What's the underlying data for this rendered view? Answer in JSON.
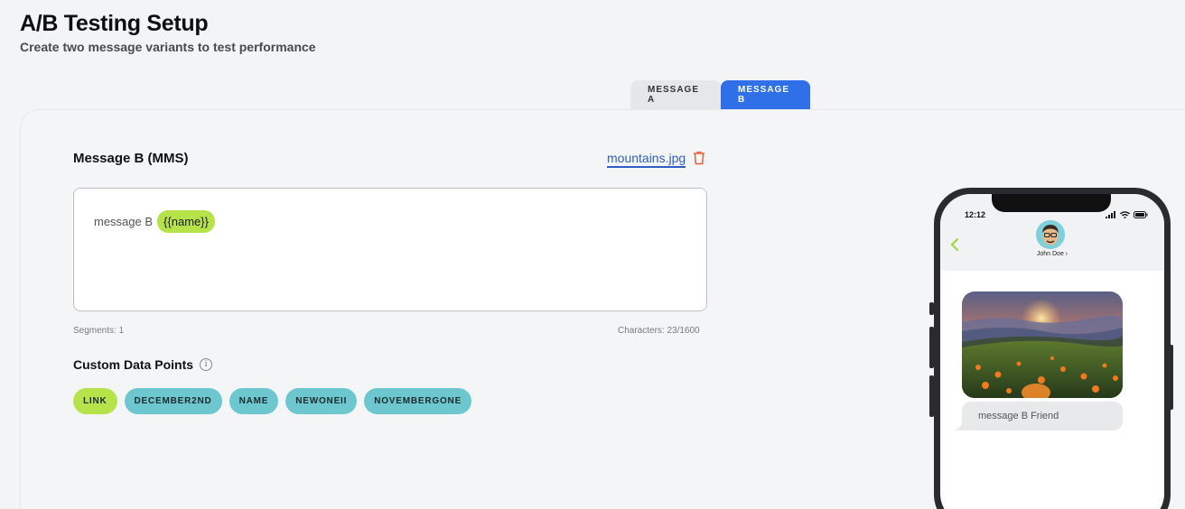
{
  "header": {
    "title": "A/B Testing Setup",
    "subtitle": "Create two message variants to test performance"
  },
  "tabs": [
    {
      "label": "MESSAGE A",
      "active": false
    },
    {
      "label": "MESSAGE B",
      "active": true
    }
  ],
  "editor": {
    "heading": "Message B (MMS)",
    "attachment_name": "mountains.jpg",
    "body_text": "message B",
    "token": "{{name}}",
    "segments": "Segments: 1",
    "characters": "Characters: 23/1600"
  },
  "custom_data_points": {
    "heading": "Custom Data Points",
    "info_glyph": "i",
    "chips": [
      {
        "label": "LINK",
        "color": "#b6e34a"
      },
      {
        "label": "DECEMBER2ND",
        "color": "#6cc7cf"
      },
      {
        "label": "NAME",
        "color": "#6cc7cf"
      },
      {
        "label": "NEWONEII",
        "color": "#6cc7cf"
      },
      {
        "label": "NOVEMBERGONE",
        "color": "#6cc7cf"
      }
    ]
  },
  "phone_preview": {
    "time": "12:12",
    "contact_name": "John Doe ›",
    "message_text": "message B Friend"
  },
  "colors": {
    "accent_blue": "#2f6fe8",
    "lime": "#b6e34a",
    "teal": "#6cc7cf",
    "trash_red": "#e8603c"
  }
}
